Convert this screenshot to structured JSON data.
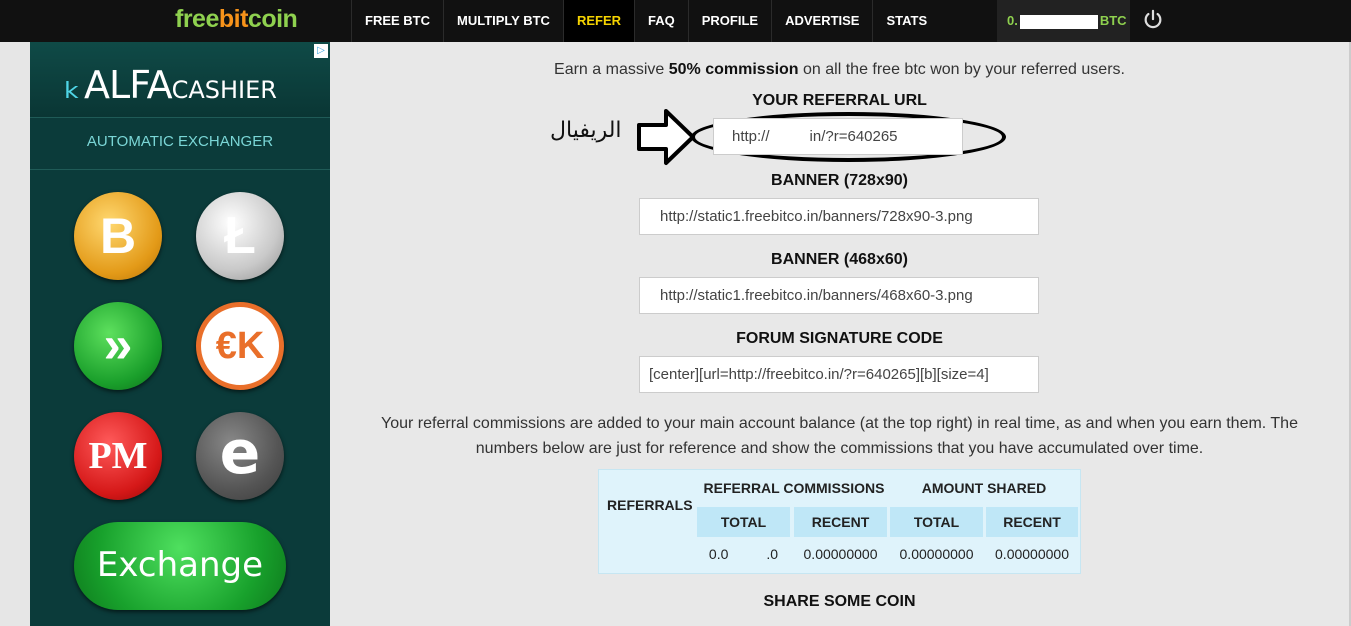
{
  "brand": {
    "part1": "free",
    "part2": "bit",
    "part3": "coin"
  },
  "nav": {
    "items": [
      {
        "label": "FREE BTC"
      },
      {
        "label": "MULTIPLY BTC"
      },
      {
        "label": "REFER"
      },
      {
        "label": "FAQ"
      },
      {
        "label": "PROFILE"
      },
      {
        "label": "ADVERTISE"
      },
      {
        "label": "STATS"
      }
    ],
    "active": "REFER",
    "balance_prefix": "0.",
    "balance_suffix": "BTC"
  },
  "ad": {
    "brand_main": "ALFA",
    "brand_small": "CASHIER",
    "subtitle": "AUTOMATIC EXCHANGER",
    "btc_symbol": "B",
    "ltc_symbol": "Ł",
    "adv_symbol": "»",
    "ok_symbol": "€K",
    "pm_symbol": "PM",
    "e_symbol": "e",
    "exchange_label": "Exchange"
  },
  "main": {
    "intro_start": "Earn a massive ",
    "intro_bold": "50% commission",
    "intro_end": " on all the free btc won by your referred users.",
    "referral_url_label": "YOUR REFERRAL URL",
    "referral_url_value": "http://",
    "referral_url_tail": "in/?r=640265",
    "annotation_arabic": "الريفيال",
    "banner1_label": "BANNER (728x90)",
    "banner1_value": "http://static1.freebitco.in/banners/728x90-3.png",
    "banner2_label": "BANNER (468x60)",
    "banner2_value": "http://static1.freebitco.in/banners/468x60-3.png",
    "forum_label": "FORUM SIGNATURE CODE",
    "forum_value": "[center][url=http://freebitco.in/?r=640265][b][size=4]",
    "paragraph": "Your referral commissions are added to your main account balance (at the top right) in real time, as and when you earn them. The numbers below are just for reference and show the commissions that you have accumulated over time.",
    "share_label": "SHARE SOME COIN"
  },
  "stats_table": {
    "col_referrals": "REFERRALS",
    "col_commissions": "REFERRAL COMMISSIONS",
    "col_shared": "AMOUNT SHARED",
    "sub_total_1": "TOTAL",
    "sub_recent_1": "RECENT",
    "sub_total_2": "TOTAL",
    "sub_recent_2": "RECENT",
    "val_referrals": "",
    "val_comm_total": "0.0",
    "val_comm_total_tail": ".0",
    "val_comm_recent": "0.00000000",
    "val_shared_total": "0.00000000",
    "val_shared_recent": "0.00000000"
  }
}
